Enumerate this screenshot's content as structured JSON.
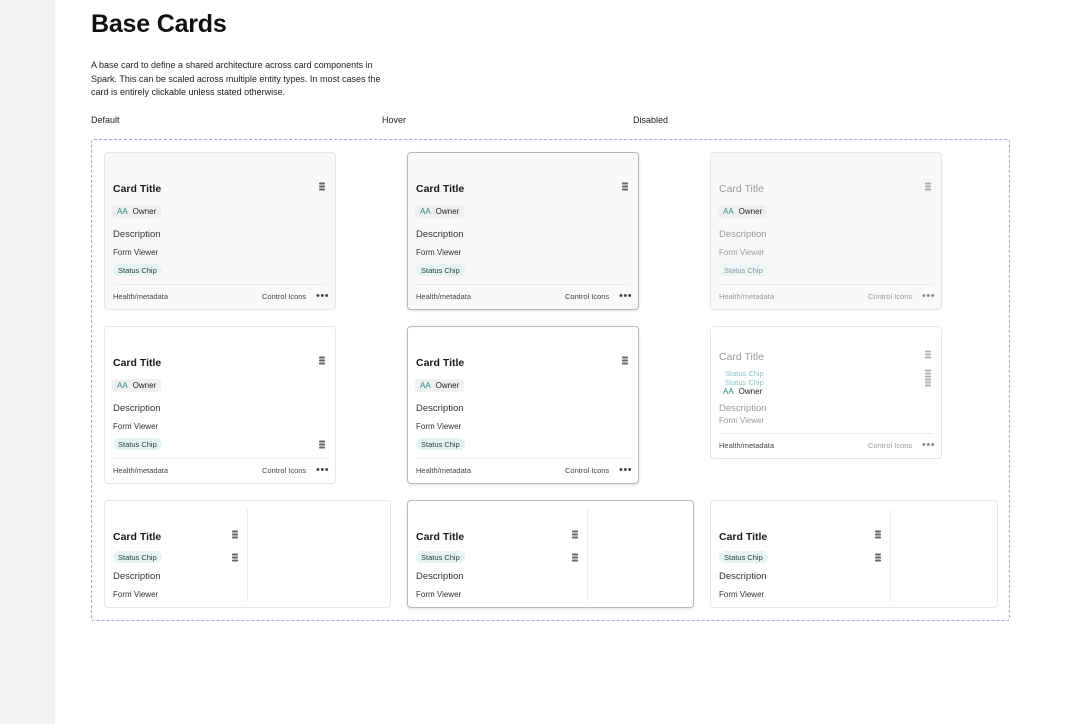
{
  "page": {
    "title": "Base Cards",
    "intro": "A base card to define a shared architecture across card components in Spark. This can be scaled across multiple entity types. In most cases the card is entirely clickable unless stated otherwise."
  },
  "columns": {
    "default": "Default",
    "hover": "Hover",
    "disabled": "Disabled"
  },
  "card": {
    "title": "Card Title",
    "owner_initials": "AA",
    "owner": "Owner",
    "description": "Description",
    "form": "Form Viewer",
    "status_chip": "Status Chip",
    "footer_left": "Health/metadata",
    "footer_controls": "Control Icons",
    "more": "•••"
  },
  "icons": {
    "stack": "stack-icon",
    "more": "more-dots-icon"
  },
  "colors": {
    "frame_border": "#a8a4d6",
    "chip_bg": "#e6f3f3",
    "owner_initials": "#2b8a8a"
  }
}
